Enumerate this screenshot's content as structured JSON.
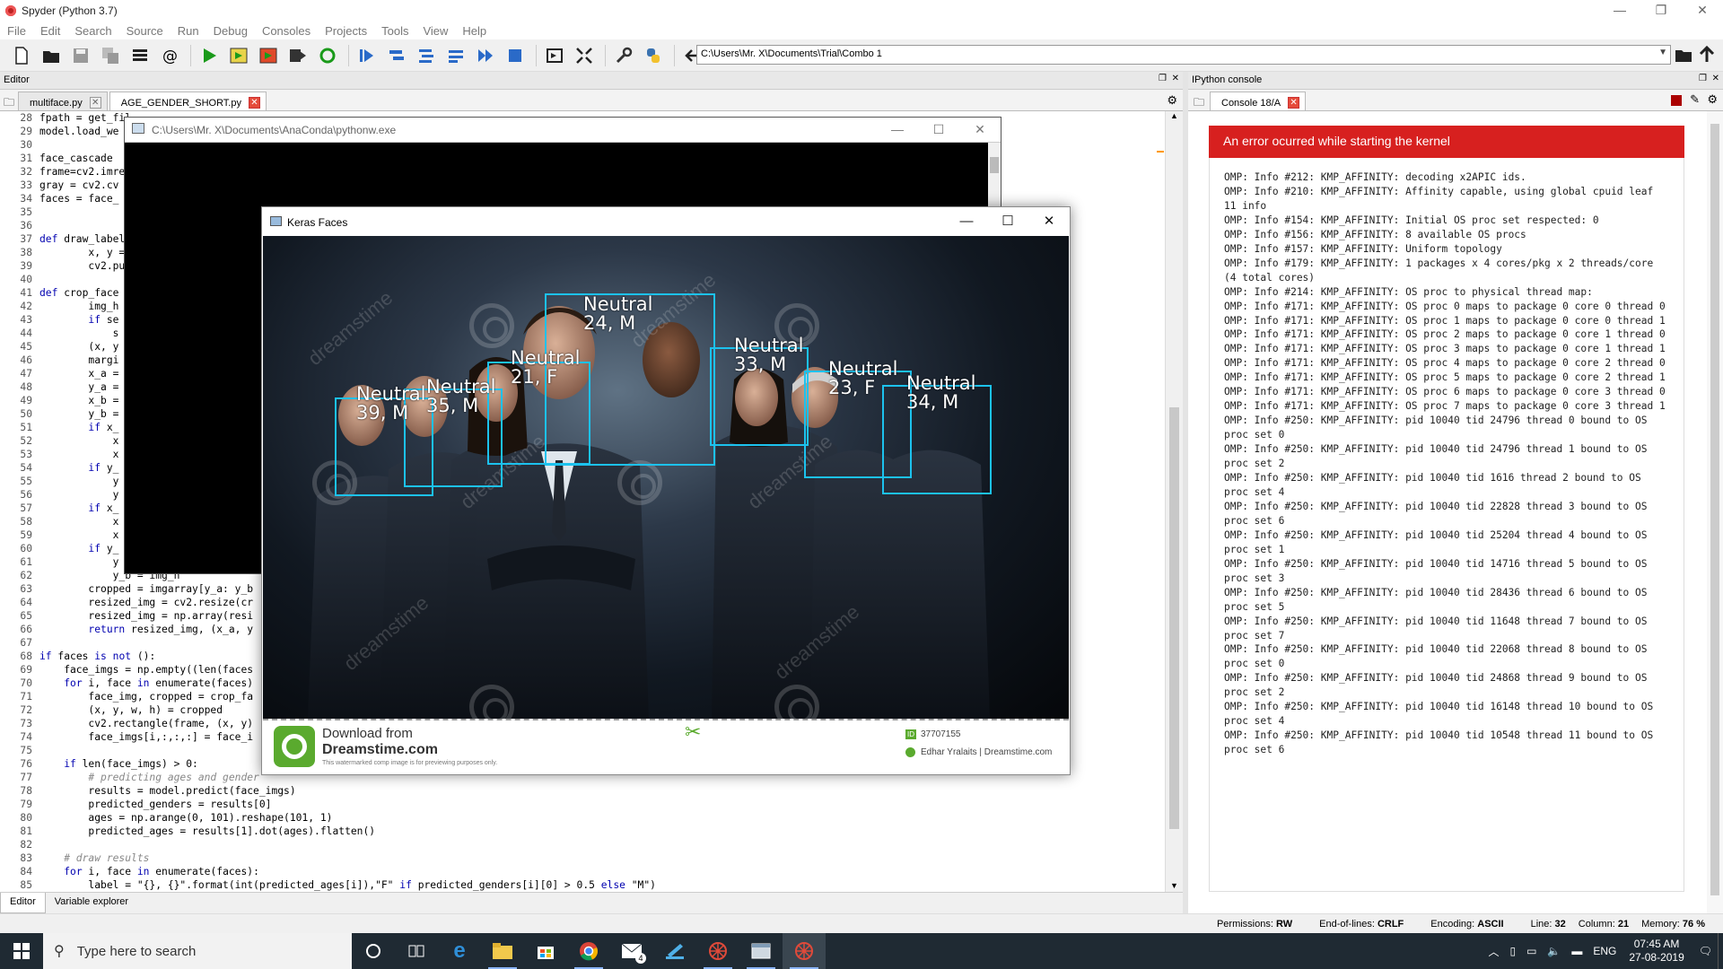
{
  "window": {
    "title": "Spyder (Python 3.7)",
    "min": "—",
    "max": "❐",
    "close": "✕"
  },
  "menu": [
    "File",
    "Edit",
    "Search",
    "Source",
    "Run",
    "Debug",
    "Consoles",
    "Projects",
    "Tools",
    "View",
    "Help"
  ],
  "toolbar": {
    "path": "C:\\Users\\Mr. X\\Documents\\Trial\\Combo 1"
  },
  "editor": {
    "pane_title": "Editor",
    "tabs": [
      {
        "label": "multiface.py"
      },
      {
        "label": "AGE_GENDER_SHORT.py"
      }
    ],
    "bottom_tabs": [
      "Editor",
      "Variable explorer"
    ],
    "lines": [
      {
        "n": "28",
        "t": "fpath = get_fil"
      },
      {
        "n": "29",
        "t": "model.load_we"
      },
      {
        "n": "30",
        "t": ""
      },
      {
        "n": "31",
        "t": "face_cascade"
      },
      {
        "n": "32",
        "t": "frame=cv2.imre"
      },
      {
        "n": "33",
        "t": "gray = cv2.cv"
      },
      {
        "n": "34",
        "t": "faces = face_"
      },
      {
        "n": "35",
        "t": ""
      },
      {
        "n": "36",
        "t": ""
      },
      {
        "n": "37",
        "t": "def draw_label"
      },
      {
        "n": "38",
        "t": "        x, y ="
      },
      {
        "n": "39",
        "t": "        cv2.pu"
      },
      {
        "n": "40",
        "t": ""
      },
      {
        "n": "41",
        "t": "def crop_face"
      },
      {
        "n": "42",
        "t": "        img_h"
      },
      {
        "n": "43",
        "t": "        if se"
      },
      {
        "n": "44",
        "t": "            s"
      },
      {
        "n": "45",
        "t": "        (x, y"
      },
      {
        "n": "46",
        "t": "        margi"
      },
      {
        "n": "47",
        "t": "        x_a ="
      },
      {
        "n": "48",
        "t": "        y_a ="
      },
      {
        "n": "49",
        "t": "        x_b ="
      },
      {
        "n": "50",
        "t": "        y_b ="
      },
      {
        "n": "51",
        "t": "        if x_"
      },
      {
        "n": "52",
        "t": "            x"
      },
      {
        "n": "53",
        "t": "            x"
      },
      {
        "n": "54",
        "t": "        if y_"
      },
      {
        "n": "55",
        "t": "            y"
      },
      {
        "n": "56",
        "t": "            y"
      },
      {
        "n": "57",
        "t": "        if x_"
      },
      {
        "n": "58",
        "t": "            x"
      },
      {
        "n": "59",
        "t": "            x"
      },
      {
        "n": "60",
        "t": "        if y_"
      },
      {
        "n": "61",
        "t": "            y"
      },
      {
        "n": "62",
        "t": "            y_b = img_h"
      },
      {
        "n": "63",
        "t": "        cropped = imgarray[y_a: y_b"
      },
      {
        "n": "64",
        "t": "        resized_img = cv2.resize(cr"
      },
      {
        "n": "65",
        "t": "        resized_img = np.array(resi"
      },
      {
        "n": "66",
        "t": "        return resized_img, (x_a, y"
      },
      {
        "n": "67",
        "t": ""
      },
      {
        "n": "68",
        "t": "if faces is not ():"
      },
      {
        "n": "69",
        "t": "    face_imgs = np.empty((len(faces"
      },
      {
        "n": "70",
        "t": "    for i, face in enumerate(faces)"
      },
      {
        "n": "71",
        "t": "        face_img, cropped = crop_fa"
      },
      {
        "n": "72",
        "t": "        (x, y, w, h) = cropped"
      },
      {
        "n": "73",
        "t": "        cv2.rectangle(frame, (x, y)"
      },
      {
        "n": "74",
        "t": "        face_imgs[i,:,:,:] = face_i"
      },
      {
        "n": "75",
        "t": ""
      },
      {
        "n": "76",
        "t": "    if len(face_imgs) > 0:"
      },
      {
        "n": "77",
        "t": "        # predicting ages and gender"
      },
      {
        "n": "78",
        "t": "        results = model.predict(face_imgs)"
      },
      {
        "n": "79",
        "t": "        predicted_genders = results[0]"
      },
      {
        "n": "80",
        "t": "        ages = np.arange(0, 101).reshape(101, 1)"
      },
      {
        "n": "81",
        "t": "        predicted_ages = results[1].dot(ages).flatten()"
      },
      {
        "n": "82",
        "t": ""
      },
      {
        "n": "83",
        "t": "    # draw results"
      },
      {
        "n": "84",
        "t": "    for i, face in enumerate(faces):"
      },
      {
        "n": "85",
        "t": "        label = \"{}, {}\".format(int(predicted_ages[i]),\"F\" if predicted_genders[i][0] > 0.5 else \"M\")"
      }
    ]
  },
  "console": {
    "pane_title": "IPython console",
    "tab": "Console 18/A",
    "error_title": "An error ocurred while starting the kernel",
    "log": "OMP: Info #212: KMP_AFFINITY: decoding x2APIC ids.\nOMP: Info #210: KMP_AFFINITY: Affinity capable, using global cpuid leaf 11 info\nOMP: Info #154: KMP_AFFINITY: Initial OS proc set respected: 0\nOMP: Info #156: KMP_AFFINITY: 8 available OS procs\nOMP: Info #157: KMP_AFFINITY: Uniform topology\nOMP: Info #179: KMP_AFFINITY: 1 packages x 4 cores/pkg x 2 threads/core (4 total cores)\nOMP: Info #214: KMP_AFFINITY: OS proc to physical thread map:\nOMP: Info #171: KMP_AFFINITY: OS proc 0 maps to package 0 core 0 thread 0\nOMP: Info #171: KMP_AFFINITY: OS proc 1 maps to package 0 core 0 thread 1\nOMP: Info #171: KMP_AFFINITY: OS proc 2 maps to package 0 core 1 thread 0\nOMP: Info #171: KMP_AFFINITY: OS proc 3 maps to package 0 core 1 thread 1\nOMP: Info #171: KMP_AFFINITY: OS proc 4 maps to package 0 core 2 thread 0\nOMP: Info #171: KMP_AFFINITY: OS proc 5 maps to package 0 core 2 thread 1\nOMP: Info #171: KMP_AFFINITY: OS proc 6 maps to package 0 core 3 thread 0\nOMP: Info #171: KMP_AFFINITY: OS proc 7 maps to package 0 core 3 thread 1\nOMP: Info #250: KMP_AFFINITY: pid 10040 tid 24796 thread 0 bound to OS proc set 0\nOMP: Info #250: KMP_AFFINITY: pid 10040 tid 24796 thread 1 bound to OS proc set 2\nOMP: Info #250: KMP_AFFINITY: pid 10040 tid 1616 thread 2 bound to OS proc set 4\nOMP: Info #250: KMP_AFFINITY: pid 10040 tid 22828 thread 3 bound to OS proc set 6\nOMP: Info #250: KMP_AFFINITY: pid 10040 tid 25204 thread 4 bound to OS proc set 1\nOMP: Info #250: KMP_AFFINITY: pid 10040 tid 14716 thread 5 bound to OS proc set 3\nOMP: Info #250: KMP_AFFINITY: pid 10040 tid 28436 thread 6 bound to OS proc set 5\nOMP: Info #250: KMP_AFFINITY: pid 10040 tid 11648 thread 7 bound to OS proc set 7\nOMP: Info #250: KMP_AFFINITY: pid 10040 tid 22068 thread 8 bound to OS proc set 0\nOMP: Info #250: KMP_AFFINITY: pid 10040 tid 24868 thread 9 bound to OS proc set 2\nOMP: Info #250: KMP_AFFINITY: pid 10040 tid 16148 thread 10 bound to OS proc set 4\nOMP: Info #250: KMP_AFFINITY: pid 10040 tid 10548 thread 11 bound to OS proc set 6"
  },
  "pythonw": {
    "title": "C:\\Users\\Mr. X\\Documents\\AnaConda\\pythonw.exe"
  },
  "keras": {
    "title": "Keras Faces",
    "faces": [
      {
        "l1": "Neutral",
        "l2": "39, M"
      },
      {
        "l1": "Neutral",
        "l2": "35, M"
      },
      {
        "l1": "Neutral",
        "l2": "21, F"
      },
      {
        "l1": "Neutral",
        "l2": "24, M"
      },
      {
        "l1": "Neutral",
        "l2": "33, M"
      },
      {
        "l1": "Neutral",
        "l2": "23, F"
      },
      {
        "l1": "Neutral",
        "l2": "34, M"
      }
    ],
    "watermark": "dreamstime",
    "footer": {
      "download": "Download from",
      "site": "Dreamstime.com",
      "note": "This watermarked comp image is for previewing purposes only.",
      "id_badge": "ID",
      "id": "37707155",
      "credit": "Edhar Yralaits | Dreamstime.com"
    }
  },
  "status": {
    "permissions_label": "Permissions:",
    "permissions": "RW",
    "eol_label": "End-of-lines:",
    "eol": "CRLF",
    "encoding_label": "Encoding:",
    "encoding": "ASCII",
    "line_label": "Line:",
    "line": "32",
    "column_label": "Column:",
    "column": "21",
    "memory_label": "Memory:",
    "memory": "76 %"
  },
  "taskbar": {
    "search_placeholder": "Type here to search",
    "time": "07:45 AM",
    "date": "27-08-2019",
    "lang": "ENG",
    "mail_badge": "4"
  },
  "colors": {
    "accent_red": "#d7201f",
    "face_box": "#1cc2ee",
    "taskbar": "#1f2a33"
  }
}
